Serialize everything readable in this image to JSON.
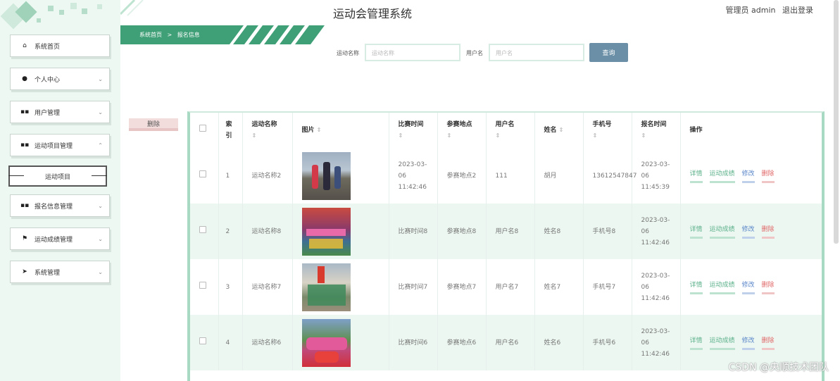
{
  "app": {
    "title": "运动会管理系统"
  },
  "user": {
    "role_label": "管理员 admin",
    "logout_label": "退出登录"
  },
  "breadcrumb": {
    "home": "系统首页",
    "separator": ">",
    "current": "报名信息"
  },
  "sidebar": {
    "items": [
      {
        "label": "系统首页",
        "icon": "home-icon",
        "glyph": "⌂"
      },
      {
        "label": "个人中心",
        "icon": "user-icon",
        "glyph": "●"
      },
      {
        "label": "用户管理",
        "icon": "grid-icon",
        "glyph": "▪▪"
      },
      {
        "label": "运动项目管理",
        "icon": "grid-icon",
        "glyph": "▪▪"
      },
      {
        "label": "报名信息管理",
        "icon": "grid-icon",
        "glyph": "▪▪"
      },
      {
        "label": "运动成绩管理",
        "icon": "flag-icon",
        "glyph": "⚑"
      },
      {
        "label": "系统管理",
        "icon": "send-icon",
        "glyph": "➤"
      }
    ],
    "submenu_label": "运动项目"
  },
  "search": {
    "field1_label": "运动名称",
    "field1_placeholder": "运动名称",
    "field2_label": "用户名",
    "field2_placeholder": "用户名",
    "button_label": "查询"
  },
  "toolbar": {
    "delete_label": "删除"
  },
  "table": {
    "headers": [
      "索引",
      "运动名称",
      "图片",
      "比赛时间",
      "参赛地点",
      "用户名",
      "姓名",
      "手机号",
      "报名时间",
      "操作"
    ],
    "sort_glyph": "⇕",
    "rows": [
      {
        "index": "1",
        "sport": "运动名称2",
        "time": "2023-03-06 11:42:46",
        "place": "参赛地点2",
        "username": "111",
        "name": "胡月",
        "phone": "13612547847",
        "signup": "2023-03-06 11:45:39"
      },
      {
        "index": "2",
        "sport": "运动名称8",
        "time": "比赛时间8",
        "place": "参赛地点8",
        "username": "用户名8",
        "name": "姓名8",
        "phone": "手机号8",
        "signup": "2023-03-06 11:42:46"
      },
      {
        "index": "3",
        "sport": "运动名称7",
        "time": "比赛时间7",
        "place": "参赛地点7",
        "username": "用户名7",
        "name": "姓名7",
        "phone": "手机号7",
        "signup": "2023-03-06 11:42:46"
      },
      {
        "index": "4",
        "sport": "运动名称6",
        "time": "比赛时间6",
        "place": "参赛地点6",
        "username": "用户名6",
        "name": "姓名6",
        "phone": "手机号6",
        "signup": "2023-03-06 11:42:46"
      }
    ],
    "actions": {
      "detail": "详情",
      "score": "运动成绩",
      "edit": "修改",
      "delete": "删除"
    }
  },
  "watermark": "CSDN @央顺技术团队",
  "colors": {
    "accent": "#4fae85",
    "sidebar_bg": "#eef8f3",
    "row_alt": "#ecf7f1",
    "search_button": "#6b8fa6",
    "delete": "#e06666"
  }
}
